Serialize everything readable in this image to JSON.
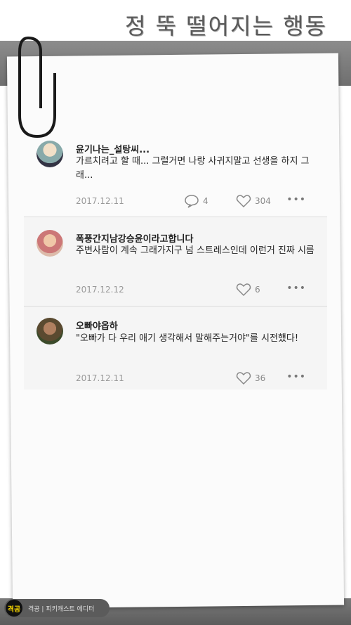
{
  "header": {
    "title": "정 뚝 떨어지는 행동"
  },
  "comments": [
    {
      "author": "윤기나는_설탕씨...",
      "text": "가르치려고 할 때... 그럴거면 나랑 사귀지말고 선생을 하지 그래...",
      "date": "2017.12.11",
      "replies": "4",
      "likes": "304"
    },
    {
      "author": "폭풍간지남강승윤이라고합니다",
      "text": "주변사람이 계속 그래가지구 넘 스트레스인데 이런거 진짜 시름",
      "date": "2017.12.12",
      "likes": "6"
    },
    {
      "author": "오빠야옵하",
      "text": "\"오빠가 다 우리 애기 생각해서 말해주는거야\"를 시전했다!",
      "date": "2017.12.11",
      "likes": "36"
    }
  ],
  "watermark": {
    "logo": "격공",
    "text": "격공 | 피키캐스트 에디터"
  }
}
